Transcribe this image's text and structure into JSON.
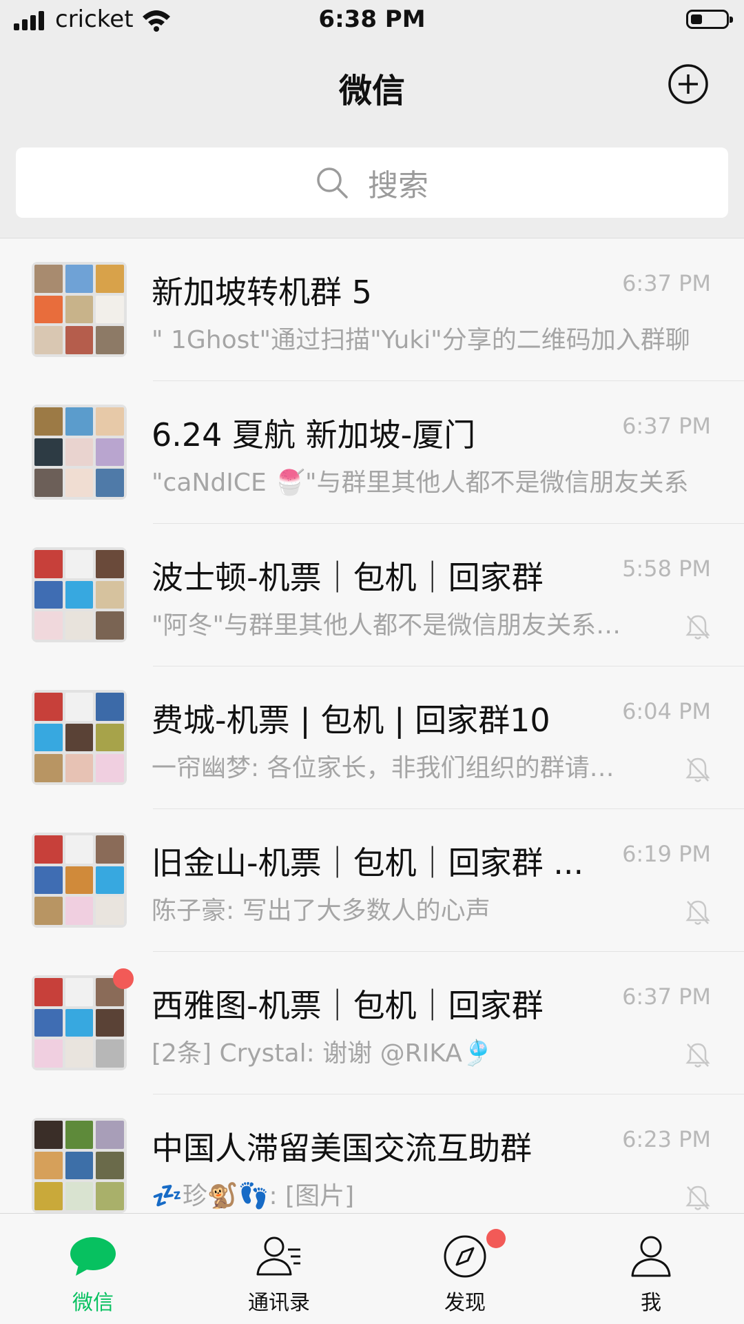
{
  "status_bar": {
    "carrier": "cricket",
    "time": "6:38 PM"
  },
  "nav": {
    "title": "微信"
  },
  "search": {
    "placeholder": "搜索"
  },
  "chats": [
    {
      "title": "新加坡转机群 5",
      "time": "6:37 PM",
      "preview": "\" 1Ghost\"通过扫描\"Yuki\"分享的二维码加入群聊",
      "muted": false,
      "unread_dot": false
    },
    {
      "title": "6.24 夏航 新加坡-厦门",
      "time": "6:37 PM",
      "preview": "\"caNdICE 🍧\"与群里其他人都不是微信朋友关系",
      "muted": false,
      "unread_dot": false
    },
    {
      "title": "波士顿-机票｜包机｜回家群",
      "time": "5:58 PM",
      "preview": "\"阿冬\"与群里其他人都不是微信朋友关系，请注意隐私安全",
      "muted": true,
      "unread_dot": false
    },
    {
      "title": "费城-机票 | 包机 | 回家群10",
      "time": "6:04 PM",
      "preview": "一帘幽梦: 各位家长，非我们组织的群请谨慎",
      "muted": true,
      "unread_dot": false
    },
    {
      "title": "旧金山-机票｜包机｜回家群 ...",
      "time": "6:19 PM",
      "preview": "陈子豪: 写出了大多数人的心声",
      "muted": true,
      "unread_dot": false
    },
    {
      "title": "西雅图-机票｜包机｜回家群",
      "time": "6:37 PM",
      "preview": "[2条] Crystal: 谢谢 @RIKA🎐",
      "muted": true,
      "unread_dot": true
    },
    {
      "title": "中国人滞留美国交流互助群",
      "time": "6:23 PM",
      "preview": "💤珍🐒👣: [图片]",
      "muted": true,
      "unread_dot": false
    }
  ],
  "tabs": [
    {
      "label": "微信",
      "icon": "chat-bubble-icon",
      "active": true
    },
    {
      "label": "通讯录",
      "icon": "contacts-icon",
      "active": false
    },
    {
      "label": "发现",
      "icon": "compass-icon",
      "active": false,
      "badge_dot": true
    },
    {
      "label": "我",
      "icon": "person-icon",
      "active": false
    }
  ],
  "colors": {
    "accent": "#07c160",
    "badge": "#f25a57",
    "background": "#ededed"
  }
}
